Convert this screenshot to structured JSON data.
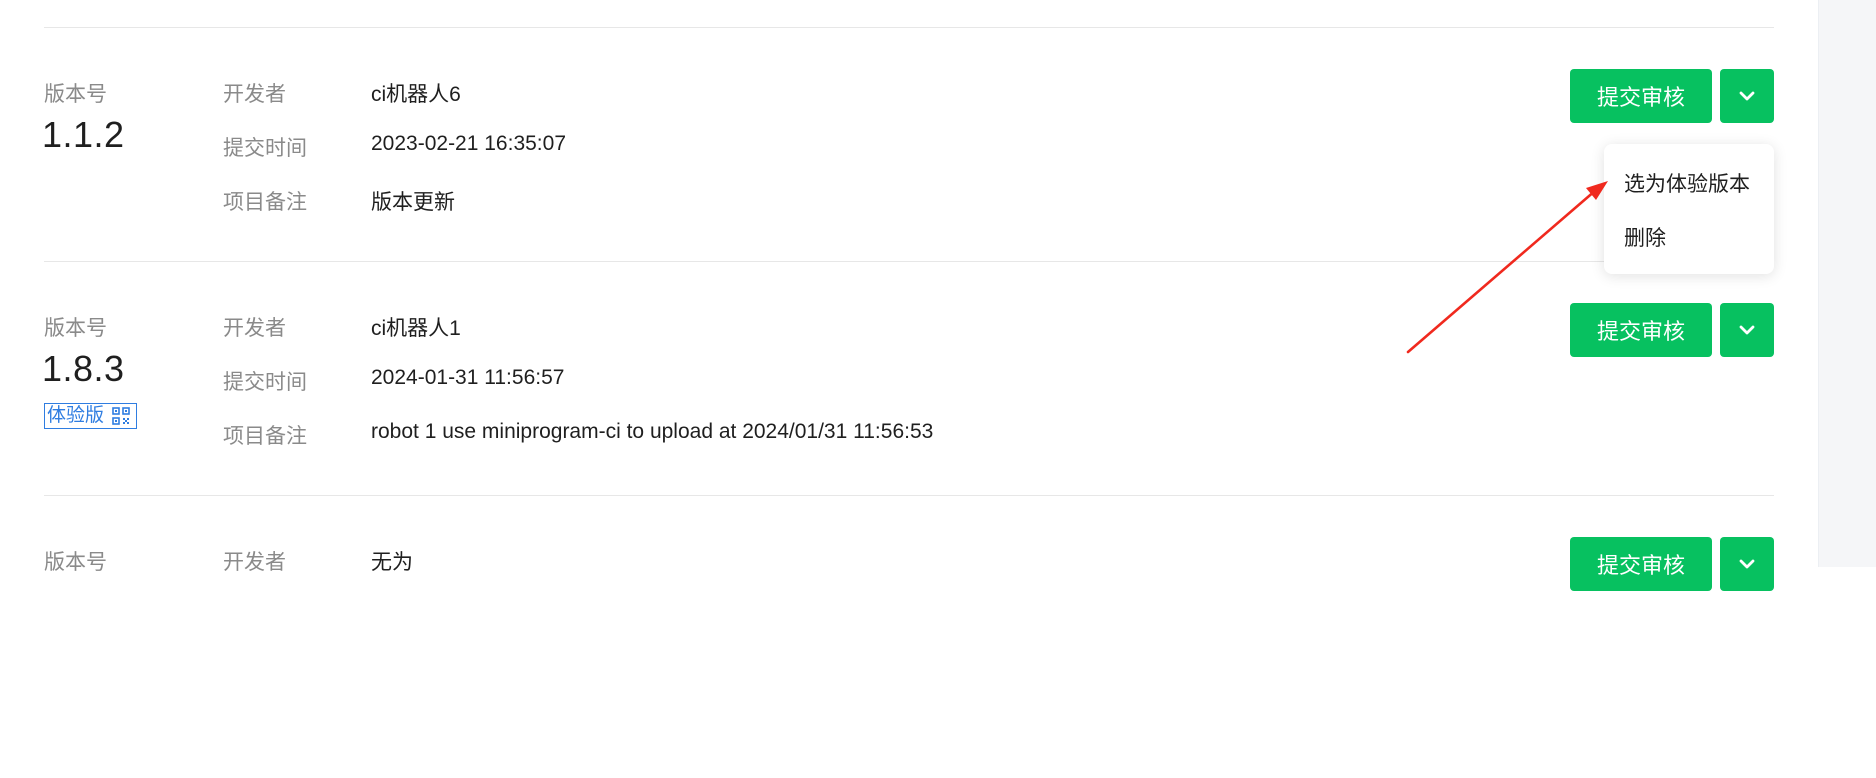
{
  "labels": {
    "version": "版本号",
    "developer": "开发者",
    "submit_time": "提交时间",
    "remark": "项目备注"
  },
  "buttons": {
    "submit_review": "提交审核"
  },
  "versions": [
    {
      "number": "1.1.2",
      "developer": "ci机器人6",
      "submit_time": "2023-02-21 16:35:07",
      "remark": "版本更新"
    },
    {
      "number": "1.8.3",
      "badge": "体验版",
      "developer": "ci机器人1",
      "submit_time": "2024-01-31 11:56:57",
      "remark": "robot 1 use miniprogram-ci to upload at 2024/01/31 11:56:53"
    },
    {
      "developer": "无为"
    }
  ],
  "dropdown": {
    "items": [
      "选为体验版本",
      "删除"
    ]
  },
  "colors": {
    "primary_green": "#07c160",
    "badge_blue": "#2f7de1",
    "annotation_red": "#f0291e"
  },
  "icons": {
    "more": "chevron-down-icon",
    "badge": "qr-code-icon"
  }
}
